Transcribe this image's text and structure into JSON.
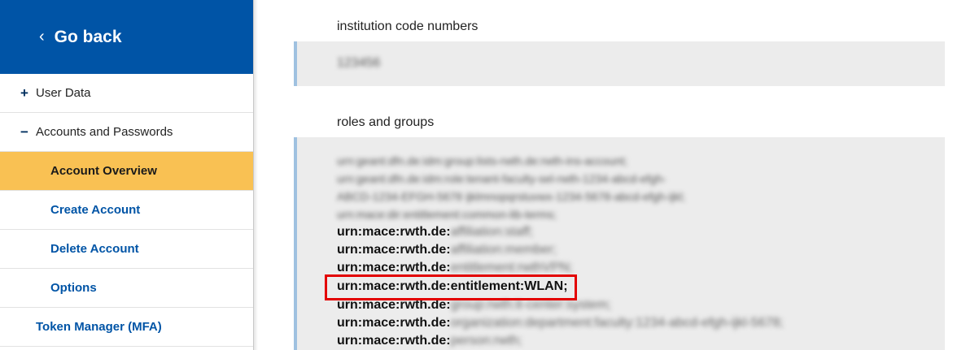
{
  "sidebar": {
    "go_back": "Go back",
    "items": [
      {
        "label": "User Data",
        "symbol": "+"
      },
      {
        "label": "Accounts and Passwords",
        "symbol": "−"
      },
      {
        "label": "Account Overview",
        "active": true
      },
      {
        "label": "Create Account"
      },
      {
        "label": "Delete Account"
      },
      {
        "label": "Options"
      },
      {
        "label": "Token Manager (MFA)"
      }
    ]
  },
  "main": {
    "institution_label": "institution code numbers",
    "institution_value": "123456",
    "roles_label": "roles and groups",
    "blurred_lines": [
      "urn:geant:dfn.de:idm:group:lists-rwth.de:rwth-ins-account;",
      "urn:geant:dfn.de:idm:role:tenant-faculty-sel-rwth-1234-abcd-efgh-",
      "ABCD-1234-EFGH-5678 ijklmnopqrstuvwx-1234-5678-abcd-efgh-ijkl;",
      "urn:mace:dir:entitlement:common-lib-terms;"
    ],
    "urn_prefix": "urn:mace:rwth.de:",
    "urn_lines": [
      {
        "prefix": "urn:mace:rwth.de:",
        "suffix": "affiliation:staff;"
      },
      {
        "prefix": "urn:mace:rwth.de:",
        "suffix": "affiliation:member;"
      },
      {
        "prefix": "urn:mace:rwth.de:",
        "suffix": "entitlement:rwthVPN;"
      },
      {
        "prefix": "urn:mace:rwth.de:",
        "suffix": "entitlement:WLAN;",
        "highlighted": true
      },
      {
        "prefix": "urn:mace:rwth.de:",
        "suffix": "group:rwth:it-center:system;"
      },
      {
        "prefix": "urn:mace:rwth.de:",
        "suffix": "organization:department:faculty:1234-abcd-efgh-ijkl-5678;"
      },
      {
        "prefix": "urn:mace:rwth.de:",
        "suffix": "person:rwth;"
      }
    ]
  },
  "colors": {
    "brand_blue": "#0054a6",
    "active_yellow": "#f9c153",
    "highlight_red": "#e30000",
    "box_bg": "#ececec",
    "box_border": "#9fc1e0"
  }
}
